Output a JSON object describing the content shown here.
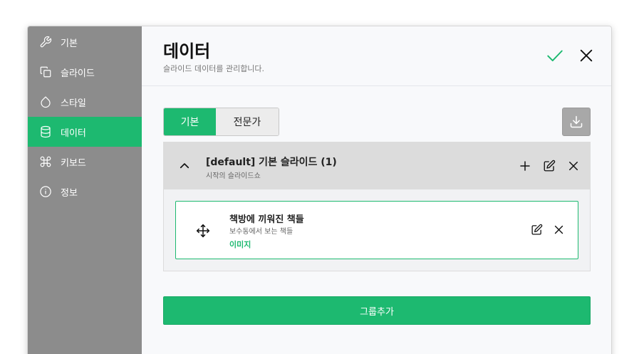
{
  "colors": {
    "accent": "#1db970",
    "sidebar_bg": "#8c8c8c"
  },
  "sidebar": {
    "items": [
      {
        "label": "기본",
        "icon": "wrench-icon"
      },
      {
        "label": "슬라이드",
        "icon": "copy-icon"
      },
      {
        "label": "스타일",
        "icon": "droplet-icon"
      },
      {
        "label": "데이터",
        "icon": "database-icon",
        "active": true
      },
      {
        "label": "키보드",
        "icon": "command-icon"
      },
      {
        "label": "정보",
        "icon": "info-icon"
      }
    ]
  },
  "header": {
    "title": "데이터",
    "subtitle": "슬라이드 데이터를 관리합니다."
  },
  "tabs": {
    "basic": "기본",
    "expert": "전문가",
    "selected": "basic"
  },
  "group": {
    "title": "[default] 기본 슬라이드 (1)",
    "description": "시작의 슬라이드쇼",
    "expanded": true,
    "items": [
      {
        "title": "책방에 끼워진 책들",
        "description": "보수동에서 보는 책들",
        "type": "이미지"
      }
    ]
  },
  "add_group_label": "그룹추가"
}
